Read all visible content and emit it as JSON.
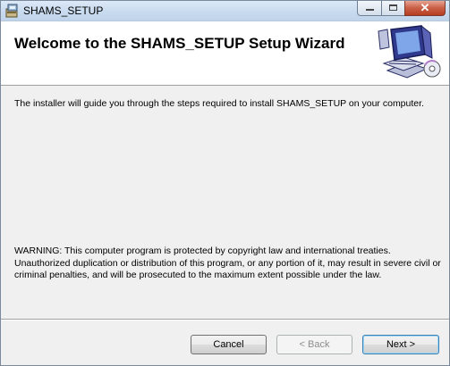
{
  "window": {
    "title": "SHAMS_SETUP",
    "app_icon": "installer-icon",
    "caption_buttons": {
      "minimize": "minimize-icon",
      "maximize": "maximize-icon",
      "close": "✕"
    }
  },
  "banner": {
    "heading": "Welcome to the SHAMS_SETUP Setup Wizard",
    "art": "computer-disc-icon"
  },
  "content": {
    "intro": "The installer will guide you through the steps required to install SHAMS_SETUP on your computer.",
    "warning": "WARNING: This computer program is protected by copyright law and international treaties. Unauthorized duplication or distribution of this program, or any portion of it, may result in severe civil or criminal penalties, and will be prosecuted to the maximum extent possible under the law."
  },
  "buttons": {
    "cancel": "Cancel",
    "back": "< Back",
    "next": "Next >"
  },
  "colors": {
    "window_bg": "#f0f0f0",
    "banner_bg": "#ffffff",
    "close_button": "#c95f46",
    "default_button_border": "#3c7fb1"
  }
}
